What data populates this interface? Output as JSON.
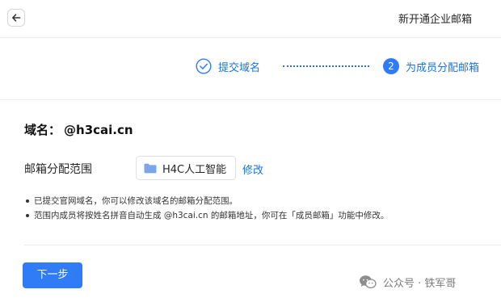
{
  "header": {
    "title": "新开通企业邮箱"
  },
  "steps": [
    {
      "label": "提交域名",
      "state": "done"
    },
    {
      "number": "2",
      "label": "为成员分配邮箱",
      "state": "active"
    }
  ],
  "domain": {
    "label": "域名：",
    "value": "@h3cai.cn"
  },
  "scope": {
    "label": "邮箱分配范围",
    "department": "H4C人工智能",
    "edit_label": "修改"
  },
  "notes": [
    "已提交官网域名，你可以修改该域名的邮箱分配范围。",
    "范围内成员将按姓名拼音自动生成 @h3cai.cn 的邮箱地址，你可在「成员邮箱」功能中修改。"
  ],
  "next_button": "下一步",
  "watermark": "公众号 · 铁军哥",
  "colors": {
    "accent": "#2f7cf6",
    "link": "#1a73e8",
    "folder": "#7aa7ea"
  },
  "icons": {
    "back": "arrow-left-icon",
    "step_done": "check-circle-icon",
    "department": "folder-icon",
    "watermark": "wechat-icon"
  }
}
